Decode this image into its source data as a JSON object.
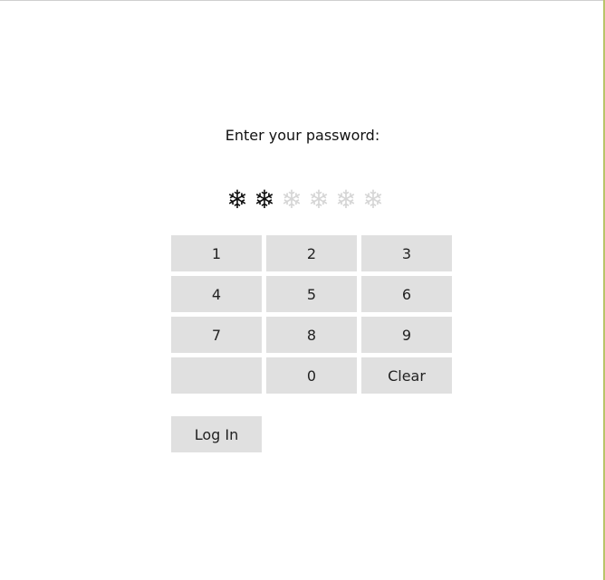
{
  "prompt": "Enter your password:",
  "pin": {
    "length": 6,
    "filled": 2,
    "filled_symbol": "❄",
    "empty_symbol": "❄"
  },
  "keypad": {
    "keys": [
      "1",
      "2",
      "3",
      "4",
      "5",
      "6",
      "7",
      "8",
      "9",
      "",
      "0",
      "Clear"
    ]
  },
  "login_label": "Log In",
  "colors": {
    "background": "#ffffff",
    "key": "#e0e0e0",
    "pin_filled": "#111111",
    "pin_empty": "#d6d6d6"
  }
}
